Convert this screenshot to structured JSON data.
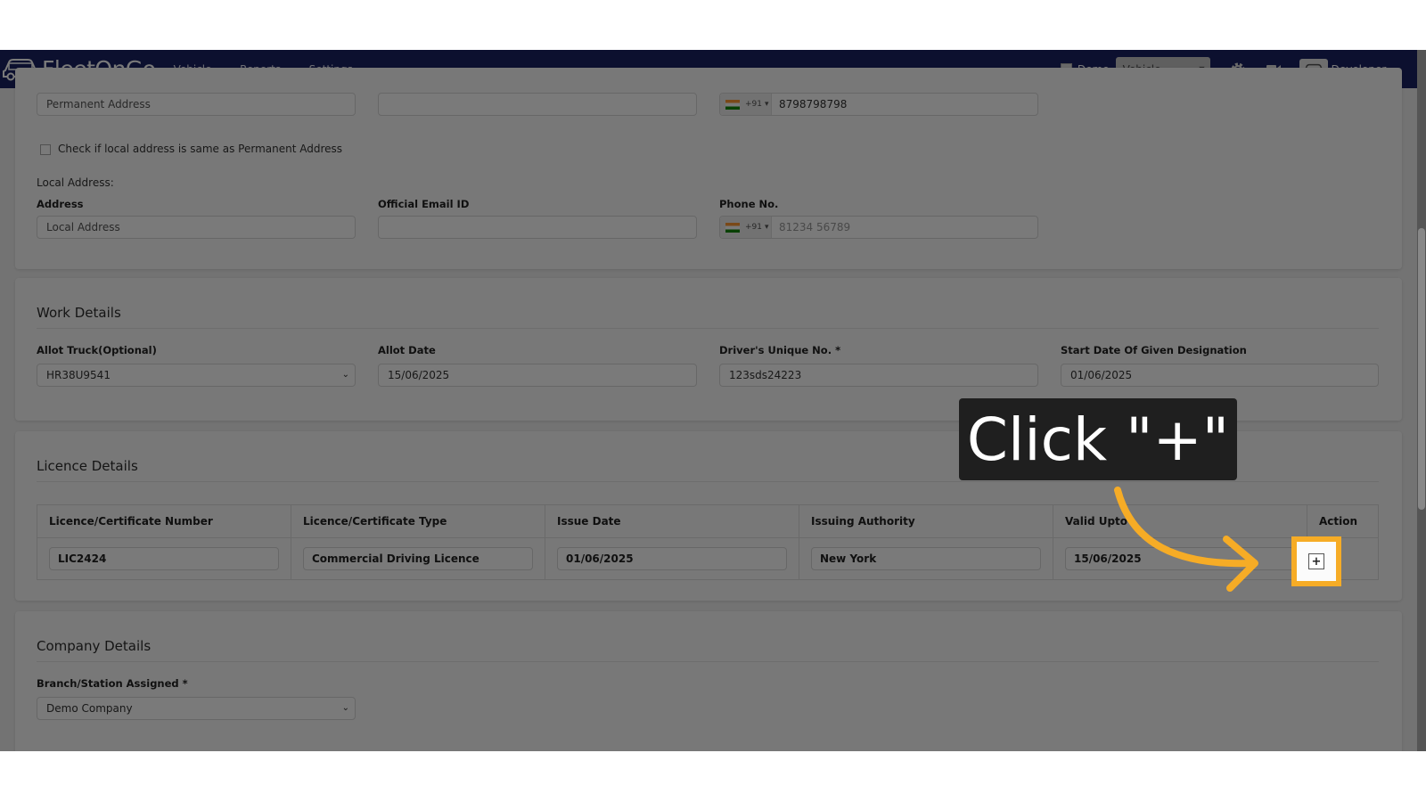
{
  "navbar": {
    "logo_text": "FleetOnGo",
    "menu": [
      {
        "label": "Vehicle"
      },
      {
        "label": "Reports"
      },
      {
        "label": "Settings"
      }
    ],
    "demo_label": "Demo",
    "vehicle_select_placeholder": "Vehicle...",
    "user_label": "Developer"
  },
  "permanent": {
    "address_placeholder": "Permanent Address",
    "email_value": "",
    "phone_prefix": "+91",
    "phone_value": "8798798798"
  },
  "same_address_checkbox_label": "Check if local address is same as Permanent Address",
  "local": {
    "section_label": "Local Address:",
    "address_label": "Address",
    "address_placeholder": "Local Address",
    "email_label": "Official Email ID",
    "email_value": "",
    "phone_label": "Phone No.",
    "phone_prefix": "+91",
    "phone_placeholder": "81234 56789"
  },
  "work": {
    "title": "Work Details",
    "allot_truck_label": "Allot Truck(Optional)",
    "allot_truck_value": "HR38U9541",
    "allot_date_label": "Allot Date",
    "allot_date_value": "15/06/2025",
    "unique_no_label": "Driver's Unique No. *",
    "unique_no_value": "123sds24223",
    "start_date_label": "Start Date Of Given Designation",
    "start_date_value": "01/06/2025"
  },
  "licence": {
    "title": "Licence Details",
    "columns": [
      "Licence/Certificate Number",
      "Licence/Certificate Type",
      "Issue Date",
      "Issuing Authority",
      "Valid Upto",
      "Action"
    ],
    "row": [
      "LIC2424",
      "Commercial Driving Licence",
      "01/06/2025",
      "New York",
      "15/06/2025"
    ],
    "add_symbol": "+"
  },
  "company": {
    "title": "Company Details",
    "branch_label": "Branch/Station Assigned *",
    "branch_value": "Demo Company"
  },
  "callout": {
    "text": "Click \"+\""
  },
  "colors": {
    "navbar": "#1a2262",
    "highlight": "#f6ac26",
    "callout_bg": "#1f1f1f"
  }
}
